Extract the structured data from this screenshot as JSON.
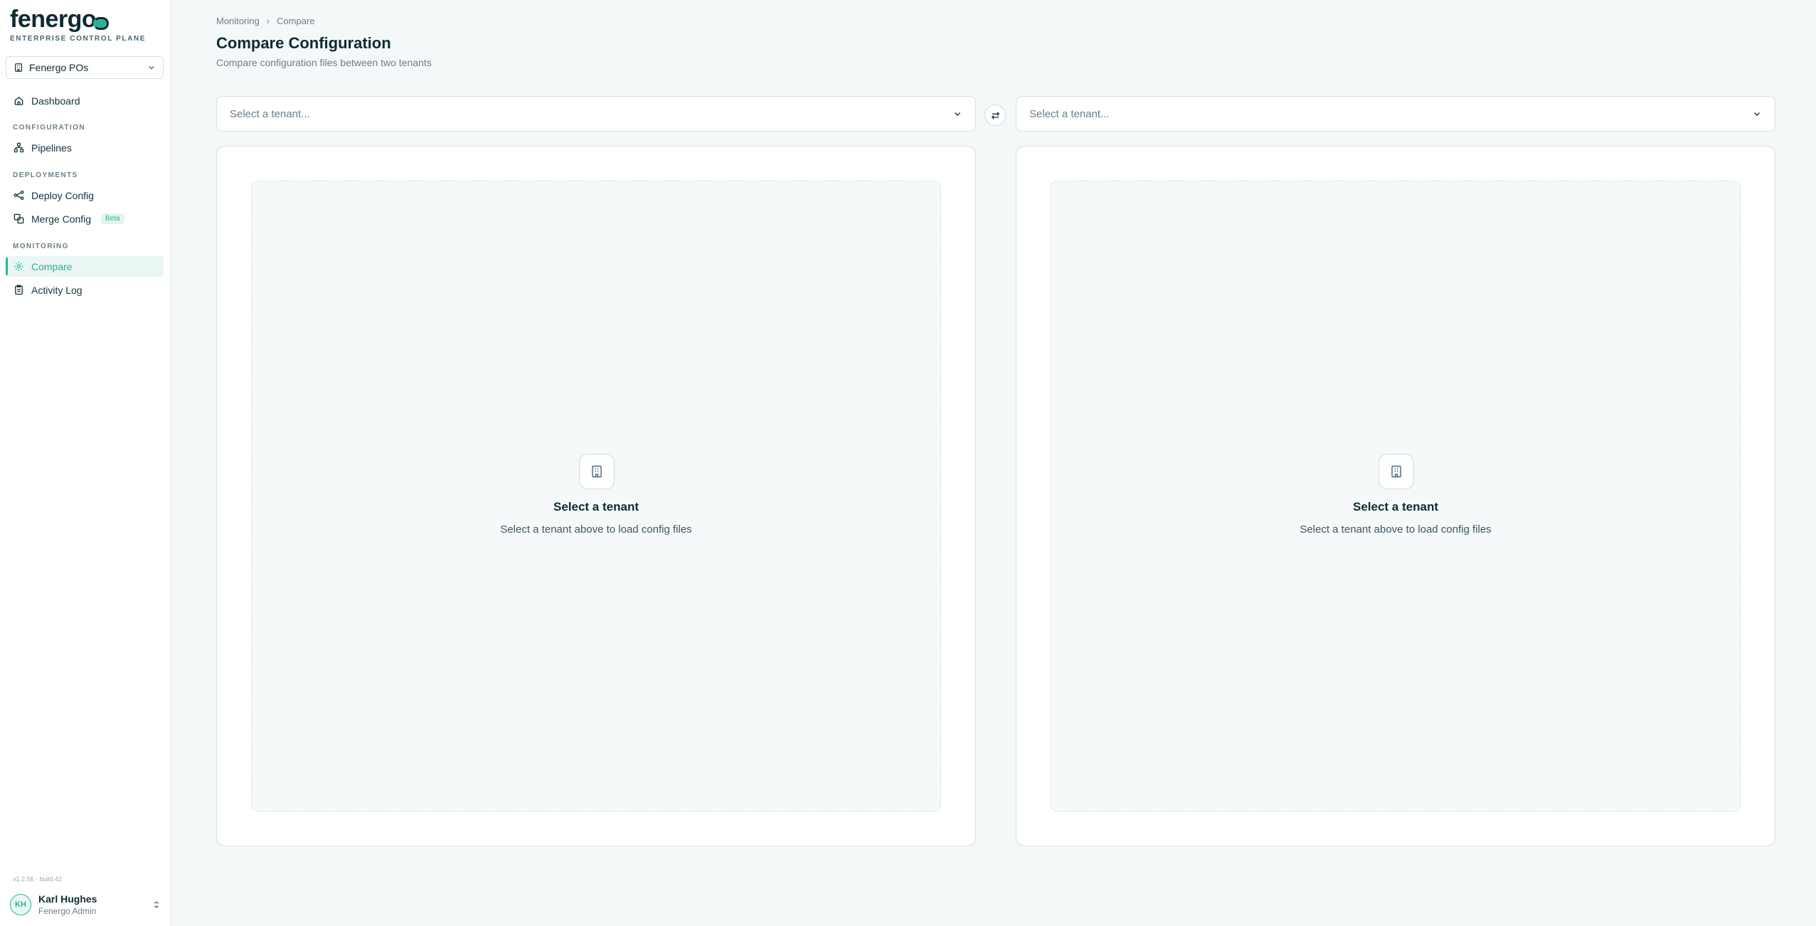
{
  "brand": {
    "logo_text": "fenergo",
    "tagline": "ENTERPRISE CONTROL PLANE"
  },
  "workspace": {
    "label": "Fenergo POs",
    "icon": "building-icon"
  },
  "sidebar": {
    "dashboard": {
      "label": "Dashboard",
      "icon": "home-icon"
    },
    "sections": {
      "configuration": "CONFIGURATION",
      "deployments": "DEPLOYMENTS",
      "monitoring": "MONITORING"
    },
    "pipelines": {
      "label": "Pipelines",
      "icon": "pipeline-icon"
    },
    "deploy_config": {
      "label": "Deploy Config",
      "icon": "share-nodes-icon"
    },
    "merge_config": {
      "label": "Merge Config",
      "icon": "merge-icon",
      "badge": "Beta"
    },
    "compare": {
      "label": "Compare",
      "icon": "compare-icon",
      "active": true
    },
    "activity_log": {
      "label": "Activity Log",
      "icon": "clipboard-icon"
    }
  },
  "version": "v1.2.56 · build 42",
  "user": {
    "initials": "KH",
    "name": "Karl Hughes",
    "role": "Fenergo Admin"
  },
  "breadcrumb": {
    "parent": "Monitoring",
    "separator": "›",
    "current": "Compare"
  },
  "page": {
    "title": "Compare Configuration",
    "subtitle": "Compare configuration files between two tenants"
  },
  "selectors": {
    "left_placeholder": "Select a tenant...",
    "right_placeholder": "Select a tenant..."
  },
  "panels": {
    "left": {
      "empty_title": "Select a tenant",
      "empty_subtitle": "Select a tenant above to load config files"
    },
    "right": {
      "empty_title": "Select a tenant",
      "empty_subtitle": "Select a tenant above to load config files"
    }
  },
  "colors": {
    "accent": "#2bb39a",
    "text_primary": "#0f2a33",
    "text_muted": "#6a8088",
    "background": "#f4f8f8"
  }
}
